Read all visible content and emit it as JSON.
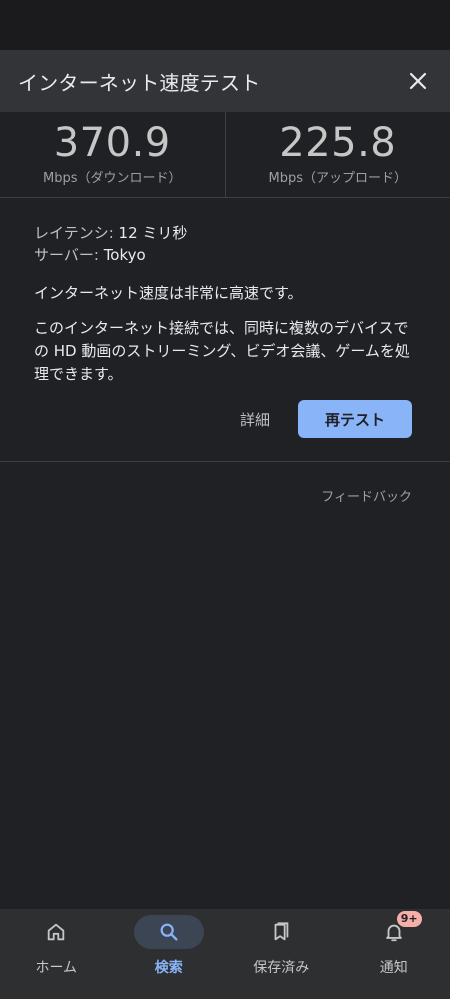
{
  "header": {
    "title": "インターネット速度テスト",
    "close_icon": "close-icon"
  },
  "speeds": {
    "download": {
      "value": "370.9",
      "unit": "Mbps（ダウンロード）"
    },
    "upload": {
      "value": "225.8",
      "unit": "Mbps（アップロード）"
    }
  },
  "details": {
    "latency_label": "レイテンシ:",
    "latency_value": "12 ミリ秒",
    "server_label": "サーバー:",
    "server_value": "Tokyo",
    "summary": "インターネット速度は非常に高速です。",
    "description": "このインターネット接続では、同時に複数のデバイスでの HD 動画のストリーミング、ビデオ会議、ゲームを処理できます。",
    "details_label": "詳細",
    "retest_label": "再テスト"
  },
  "feedback_label": "フィードバック",
  "bottom_nav": {
    "items": [
      {
        "label": "ホーム",
        "icon": "home-icon",
        "active": false
      },
      {
        "label": "検索",
        "icon": "search-icon",
        "active": true
      },
      {
        "label": "保存済み",
        "icon": "bookmark-icon",
        "active": false
      },
      {
        "label": "通知",
        "icon": "bell-icon",
        "active": false,
        "badge": "9+"
      }
    ]
  },
  "colors": {
    "accent": "#8ab4f8",
    "background": "#202124",
    "header": "#323437",
    "badge": "#f6aea9"
  }
}
